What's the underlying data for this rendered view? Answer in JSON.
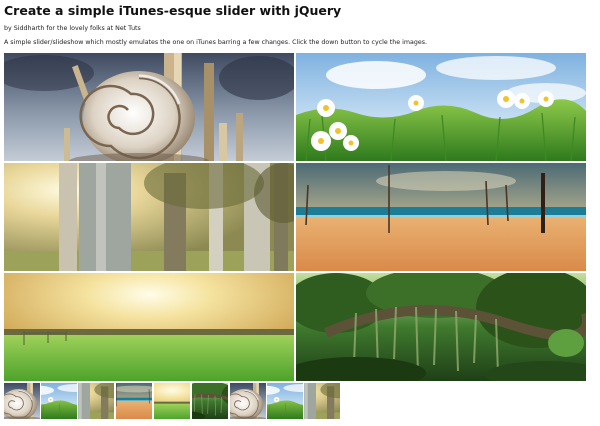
{
  "page": {
    "title": "Create a simple iTunes-esque slider with jQuery",
    "byline": "by Siddharth for the lovely folks at Net Tuts",
    "description": "A simple slider/slideshow which mostly emulates the one on iTunes barring a few changes. Click the down button to cycle the images."
  },
  "slides": [
    {
      "name": "snail"
    },
    {
      "name": "daisies"
    },
    {
      "name": "forest"
    },
    {
      "name": "beach"
    },
    {
      "name": "field"
    },
    {
      "name": "jungle"
    }
  ],
  "thumbnails": [
    "snail",
    "daisies",
    "forest",
    "beach",
    "field",
    "jungle",
    "snail",
    "daisies",
    "forest"
  ],
  "colors": {
    "background": "#ffffff",
    "text": "#111111"
  }
}
